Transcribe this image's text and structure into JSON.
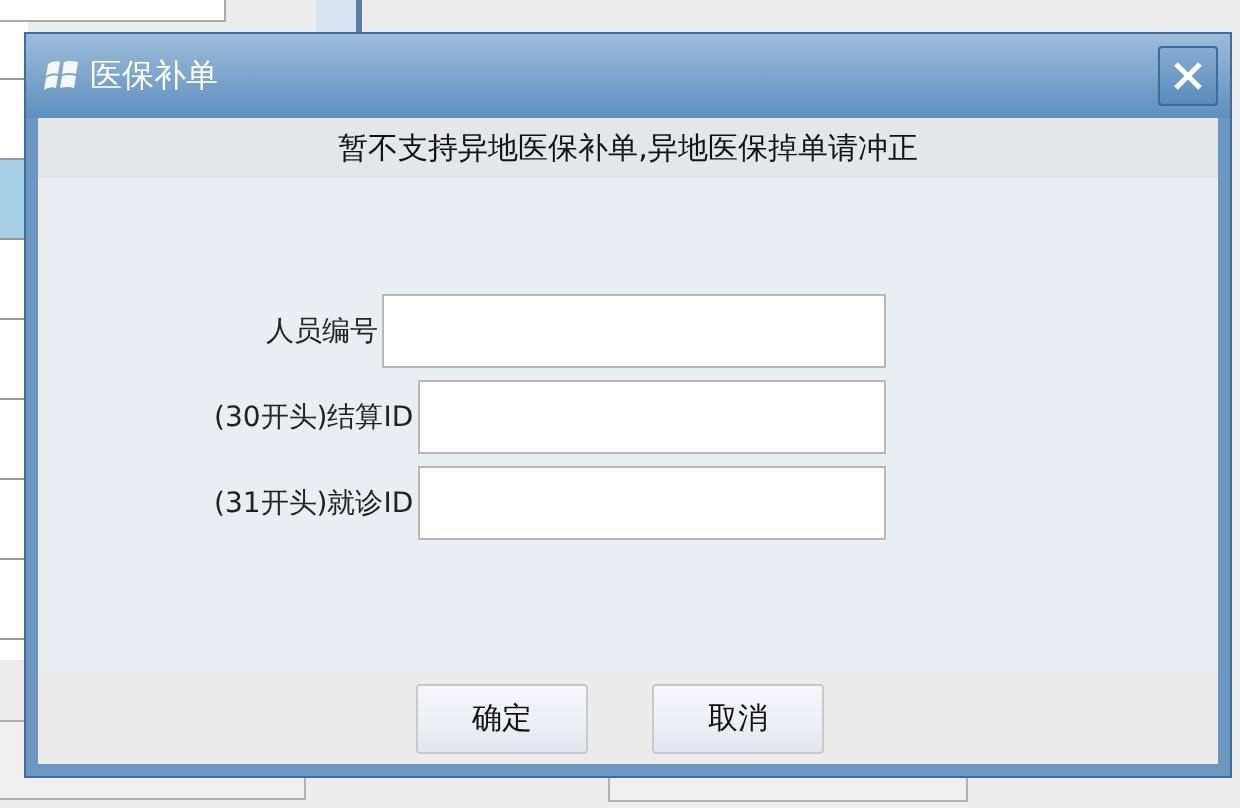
{
  "dialog": {
    "title": "医保补单",
    "notice": "暂不支持异地医保补单,异地医保掉单请冲正",
    "fields": [
      {
        "label": "人员编号"
      },
      {
        "label": "(30开头)结算ID"
      },
      {
        "label": "(31开头)就诊ID"
      }
    ],
    "buttons": [
      {
        "label": "确定"
      },
      {
        "label": "取消"
      }
    ]
  }
}
